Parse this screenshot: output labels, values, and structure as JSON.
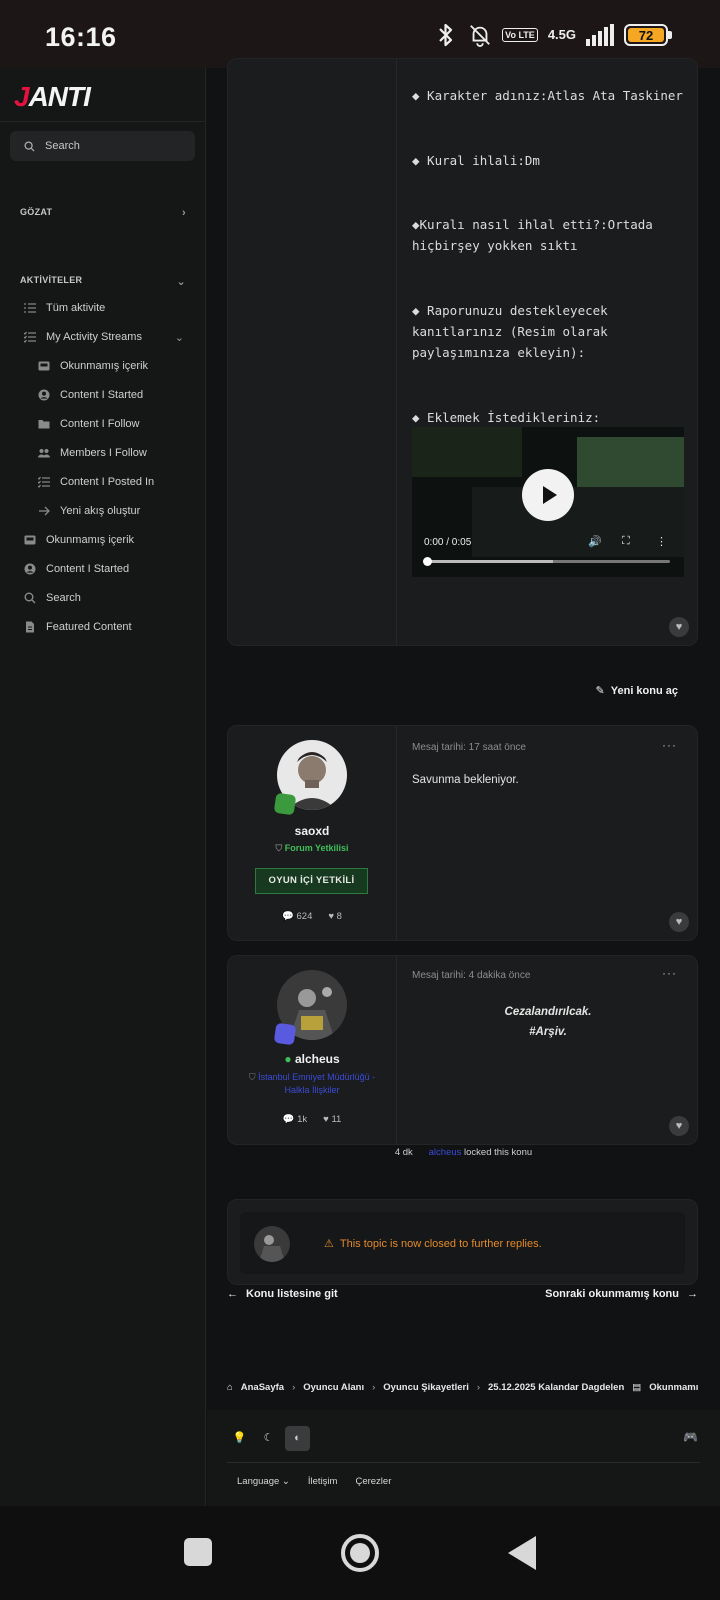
{
  "status_bar": {
    "time": "16:16",
    "volte": "Vo LTE",
    "network": "4.5G",
    "battery": "72",
    "icons": [
      "bluetooth-icon",
      "bell-off-icon",
      "signal-icon",
      "battery-icon"
    ]
  },
  "sidebar": {
    "logo_j": "J",
    "logo_rest": "ANTI",
    "search_label": "Search",
    "browse_header": "GÖZAT",
    "activity_header": "AKTİVİTELER",
    "items": [
      {
        "label": "Tüm aktivite",
        "icon": "list-icon"
      },
      {
        "label": "My Activity Streams",
        "icon": "checklist-icon"
      },
      {
        "label": "Okunmamış içerik",
        "icon": "inbox-icon"
      },
      {
        "label": "Content I Started",
        "icon": "user-circle-icon"
      },
      {
        "label": "Content I Follow",
        "icon": "folder-icon"
      },
      {
        "label": "Members I Follow",
        "icon": "users-icon"
      },
      {
        "label": "Content I Posted In",
        "icon": "checklist-icon"
      },
      {
        "label": "Yeni akış oluştur",
        "icon": "arrow-right-icon"
      },
      {
        "label": "Okunmamış içerik",
        "icon": "inbox-icon"
      },
      {
        "label": "Content I Started",
        "icon": "user-circle-icon"
      },
      {
        "label": "Search",
        "icon": "search-icon"
      },
      {
        "label": "Featured Content",
        "icon": "file-icon"
      }
    ]
  },
  "report_post": {
    "lines": [
      "◆ Karakter adınız:Atlas Ata Taskiner",
      "◆ Kural ihlali:Dm",
      "◆Kuralı nasıl ihlal etti?:Ortada hiçbirşey yokken sıktı",
      "◆ Raporunuzu destekleyecek kanıtlarınız (Resim olarak paylaşımınıza ekleyin):",
      "◆ Eklemek İstedikleriniz:"
    ],
    "video_time": "0:00 / 0:05",
    "video_progress": 0
  },
  "new_topic_label": "Yeni konu aç",
  "posts": [
    {
      "username": "saoxd",
      "role": "Forum Yetkilisi",
      "badge": "OYUN İÇİ YETKİLİ",
      "comments": "624",
      "likes": "8",
      "date": "Mesaj tarihi: 17 saat önce",
      "text": "Savunma bekleniyor."
    },
    {
      "username": "alcheus",
      "role": "İstanbul Emniyet Müdürlüğü - Halkla İlişkiler",
      "comments": "1k",
      "likes": "11",
      "date": "Mesaj tarihi: 4 dakika önce",
      "text_line1": "Cezalandırılcak.",
      "text_line2": "#Arşiv."
    }
  ],
  "lock_event": {
    "time": "4 dk",
    "who": "alcheus",
    "action": "locked this konu"
  },
  "closed_notice": "This topic is now closed to further replies.",
  "pager": {
    "prev": "Konu listesine git",
    "next": "Sonraki okunmamış konu"
  },
  "breadcrumb": [
    "AnaSayfa",
    "Oyuncu Alanı",
    "Oyuncu Şikayetleri",
    "25.12.2025 Kalandar Dagdelen",
    "Okunmamı"
  ],
  "footer": {
    "links": [
      "Language",
      "İletişim",
      "Çerezler"
    ]
  },
  "colors": {
    "accent_red": "#e3123f",
    "role_green": "#3fbf5a",
    "role_blue": "#3b4bd8",
    "warning": "#e58a2b"
  }
}
